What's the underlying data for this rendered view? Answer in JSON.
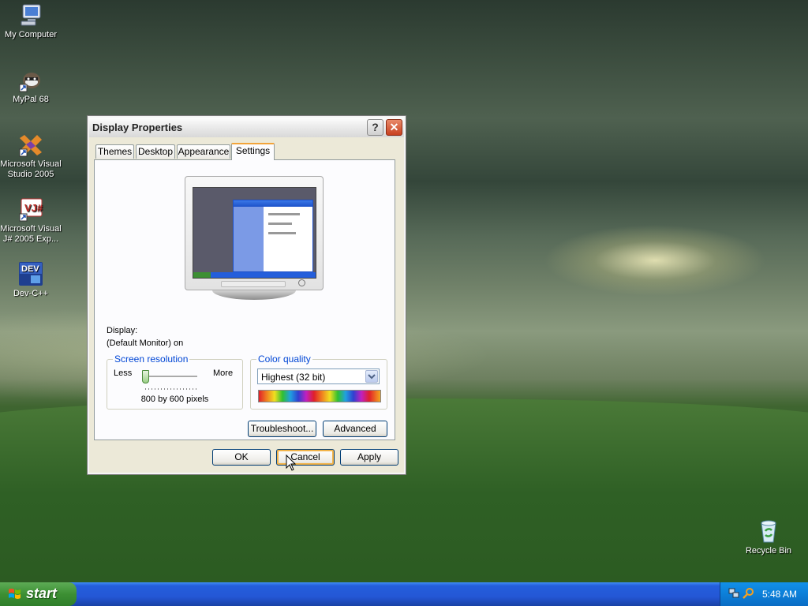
{
  "desktop": {
    "icons": [
      {
        "label": "My Computer"
      },
      {
        "label": "MyPal 68"
      },
      {
        "label": "Microsoft Visual Studio 2005"
      },
      {
        "label": "Microsoft Visual J# 2005 Exp..."
      },
      {
        "label": "Dev-C++"
      },
      {
        "label": "Recycle Bin"
      }
    ]
  },
  "dialog": {
    "title": "Display Properties",
    "help_glyph": "?",
    "close_glyph": "✕",
    "tabs": [
      "Themes",
      "Desktop",
      "Appearance",
      "Settings"
    ],
    "active_tab": "Settings",
    "display_label": "Display:",
    "display_value": "(Default Monitor) on",
    "resolution": {
      "legend": "Screen resolution",
      "less": "Less",
      "more": "More",
      "value_text": "800 by 600 pixels",
      "slider_level": 0
    },
    "color_quality": {
      "legend": "Color quality",
      "selected": "Highest (32 bit)"
    },
    "buttons": {
      "troubleshoot": "Troubleshoot...",
      "advanced": "Advanced",
      "ok": "OK",
      "cancel": "Cancel",
      "apply": "Apply"
    }
  },
  "taskbar": {
    "start_label": "start",
    "clock": "5:48 AM"
  },
  "colors": {
    "xp_blue": "#245edb",
    "start_green": "#3c8f33",
    "focus_orange": "#f2a43a"
  }
}
